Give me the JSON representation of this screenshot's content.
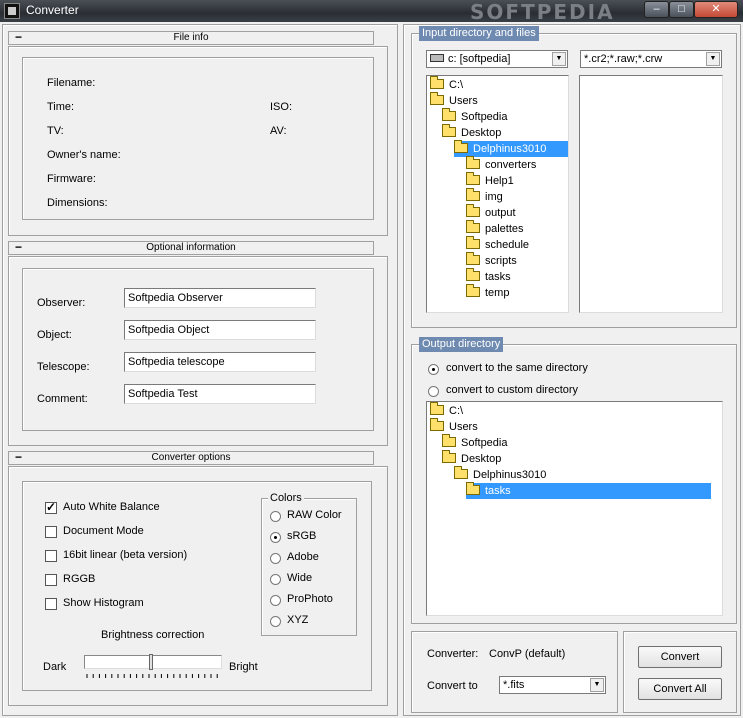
{
  "window": {
    "title": "Converter",
    "watermark": "SOFTPEDIA",
    "min": "–",
    "max": "□",
    "close": "✕"
  },
  "file_info": {
    "header": "File info",
    "filename_label": "Filename:",
    "time_label": "Time:",
    "tv_label": "TV:",
    "owner_label": "Owner's name:",
    "firmware_label": "Firmware:",
    "dimensions_label": "Dimensions:",
    "iso_label": "ISO:",
    "av_label": "AV:"
  },
  "optional": {
    "header": "Optional information",
    "observer_label": "Observer:",
    "observer_value": "Softpedia Observer",
    "object_label": "Object:",
    "object_value": "Softpedia Object",
    "telescope_label": "Telescope:",
    "telescope_value": "Softpedia telescope",
    "comment_label": "Comment:",
    "comment_value": "Softpedia Test"
  },
  "options": {
    "header": "Converter options",
    "checkboxes": [
      {
        "label": "Auto White Balance",
        "checked": true
      },
      {
        "label": "Document Mode",
        "checked": false
      },
      {
        "label": "16bit linear (beta version)",
        "checked": false
      },
      {
        "label": "RGGB",
        "checked": false
      },
      {
        "label": "Show Histogram",
        "checked": false
      }
    ],
    "colors_title": "Colors",
    "colors": [
      {
        "label": "RAW Color",
        "selected": false
      },
      {
        "label": "sRGB",
        "selected": true
      },
      {
        "label": "Adobe",
        "selected": false
      },
      {
        "label": "Wide",
        "selected": false
      },
      {
        "label": "ProPhoto",
        "selected": false
      },
      {
        "label": "XYZ",
        "selected": false
      }
    ],
    "brightness_label": "Brightness correction",
    "dark_label": "Dark",
    "bright_label": "Bright",
    "brightness_level": 0.5
  },
  "input": {
    "legend": "Input directory and files",
    "drive": "c: [softpedia]",
    "filter": "*.cr2;*.raw;*.crw",
    "tree": [
      {
        "label": "C:\\",
        "depth": 0,
        "selected": false
      },
      {
        "label": "Users",
        "depth": 0,
        "selected": false
      },
      {
        "label": "Softpedia",
        "depth": 1,
        "selected": false
      },
      {
        "label": "Desktop",
        "depth": 1,
        "selected": false
      },
      {
        "label": "Delphinus3010",
        "depth": 2,
        "selected": true
      },
      {
        "label": "converters",
        "depth": 3,
        "selected": false
      },
      {
        "label": "Help1",
        "depth": 3,
        "selected": false
      },
      {
        "label": "img",
        "depth": 3,
        "selected": false
      },
      {
        "label": "output",
        "depth": 3,
        "selected": false
      },
      {
        "label": "palettes",
        "depth": 3,
        "selected": false
      },
      {
        "label": "schedule",
        "depth": 3,
        "selected": false
      },
      {
        "label": "scripts",
        "depth": 3,
        "selected": false
      },
      {
        "label": "tasks",
        "depth": 3,
        "selected": false
      },
      {
        "label": "temp",
        "depth": 3,
        "selected": false
      }
    ]
  },
  "output": {
    "legend": "Output directory",
    "same_label": "convert to the same directory",
    "custom_label": "convert to custom directory",
    "same_selected": true,
    "tree": [
      {
        "label": "C:\\",
        "depth": 0,
        "selected": false
      },
      {
        "label": "Users",
        "depth": 0,
        "selected": false
      },
      {
        "label": "Softpedia",
        "depth": 1,
        "selected": false
      },
      {
        "label": "Desktop",
        "depth": 1,
        "selected": false
      },
      {
        "label": "Delphinus3010",
        "depth": 2,
        "selected": false
      },
      {
        "label": "tasks",
        "depth": 3,
        "selected": true
      }
    ]
  },
  "convert": {
    "converter_label": "Converter:",
    "converter_value": "ConvP (default)",
    "convert_to_label": "Convert to",
    "format": "*.fits",
    "convert_button": "Convert",
    "convert_all_button": "Convert All"
  }
}
